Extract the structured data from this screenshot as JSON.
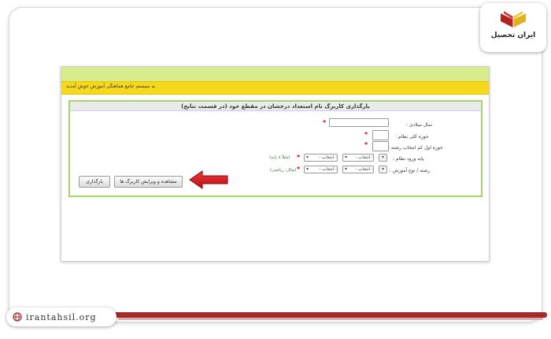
{
  "logo": {
    "brand_text": "ایران تحصیل"
  },
  "site": {
    "url": "irantahsil.org"
  },
  "page": {
    "welcome_text": "به سیستم جامع هماهنگی آموزش خوش آمدید",
    "form_title": "بارگذاری کاربرگ نام استعداد درخشان در مقطع خود (در قسمت نتایج)",
    "fields": {
      "birth_year_label": "سال میلادی :",
      "main_region_label": "حوزه کلی نظام :",
      "subject_region_label": "حوزه اول کم انتخاب رشته :",
      "entry_grade_label": "پایه ورود نظام :",
      "entry_grade_hint": "(مثلاً ۸ پایه)",
      "field_type_label": "رشته / نوع آموزش :",
      "field_type_hint": "(مثال: ریاضی)",
      "select_placeholder": "- انتخاب -",
      "required_mark": "*"
    },
    "buttons": {
      "view_edit": "مشاهده و ویرایش کاربرگ ها",
      "upload": "بارگذاری"
    }
  },
  "colors": {
    "header_green": "#d8ec8c",
    "header_yellow": "#f6d81c",
    "form_border": "#a6d66a",
    "arrow_red": "#d2141e",
    "frame_accent": "#a52a2a"
  },
  "icons": [
    "book-logo-icon",
    "globe-icon",
    "red-arrow-icon",
    "chevron-down-icon"
  ]
}
